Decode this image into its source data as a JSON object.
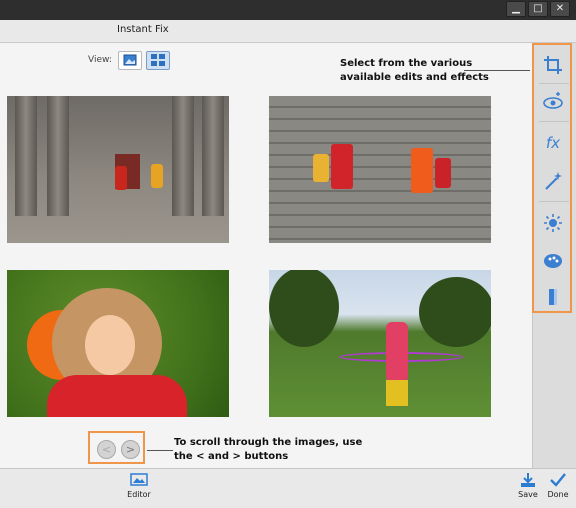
{
  "window": {
    "title": "Instant Fix",
    "controls": [
      "▁",
      "□",
      "✕"
    ]
  },
  "view": {
    "label": "View:",
    "single_icon": "single-view-icon",
    "grid_icon": "grid-view-icon"
  },
  "callouts": {
    "tools": [
      "Select from the various",
      "available edits and effects"
    ],
    "navigation": [
      "To scroll through the images, use",
      "the < and > buttons"
    ]
  },
  "nav": {
    "prev_label": "<",
    "next_label": ">"
  },
  "tools": [
    {
      "icon": "crop-icon",
      "glyph": "⌗"
    },
    {
      "icon": "red-eye-icon",
      "glyph": "◉"
    },
    {
      "icon": "fx-icon",
      "glyph": "fx"
    },
    {
      "icon": "magic-wand-icon",
      "glyph": "✦"
    },
    {
      "icon": "brightness-icon",
      "glyph": "✹"
    },
    {
      "icon": "color-palette-icon",
      "glyph": "◕"
    },
    {
      "icon": "straighten-icon",
      "glyph": "▮"
    }
  ],
  "bottom": {
    "editor_label": "Editor",
    "save_label": "Save",
    "done_label": "Done"
  },
  "colors": {
    "callout_border": "#f0964a",
    "accent_blue": "#3b7fd1"
  }
}
